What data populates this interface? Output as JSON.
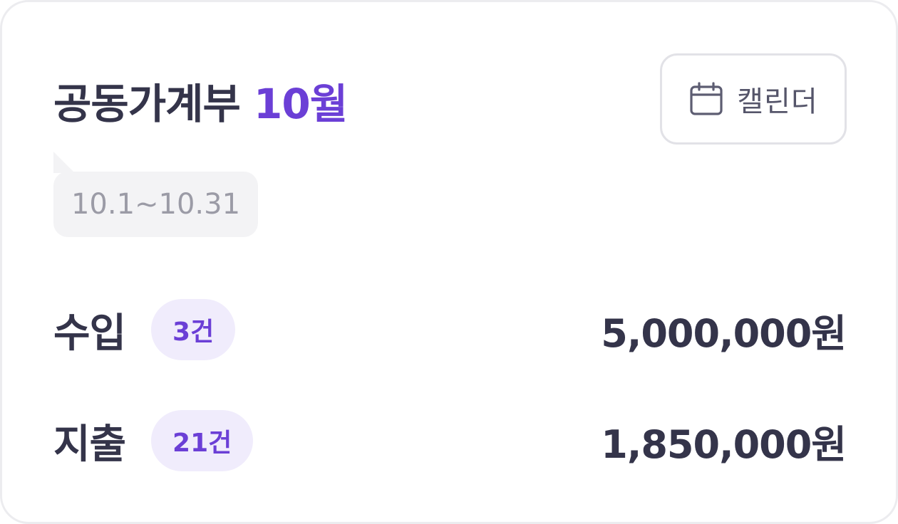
{
  "header": {
    "title": "공동가계부",
    "month": "10월",
    "calendar_button_label": "캘린더",
    "calendar_icon": "calendar-icon"
  },
  "period": {
    "range": "10.1~10.31"
  },
  "summary": {
    "income": {
      "label": "수입",
      "count": "3건",
      "amount": "5,000,000원"
    },
    "expense": {
      "label": "지출",
      "count": "21건",
      "amount": "1,850,000원"
    }
  },
  "colors": {
    "accent": "#6b3fd6",
    "text_primary": "#34344a",
    "badge_bg": "#f0ecfc",
    "bubble_bg": "#f3f3f5"
  }
}
